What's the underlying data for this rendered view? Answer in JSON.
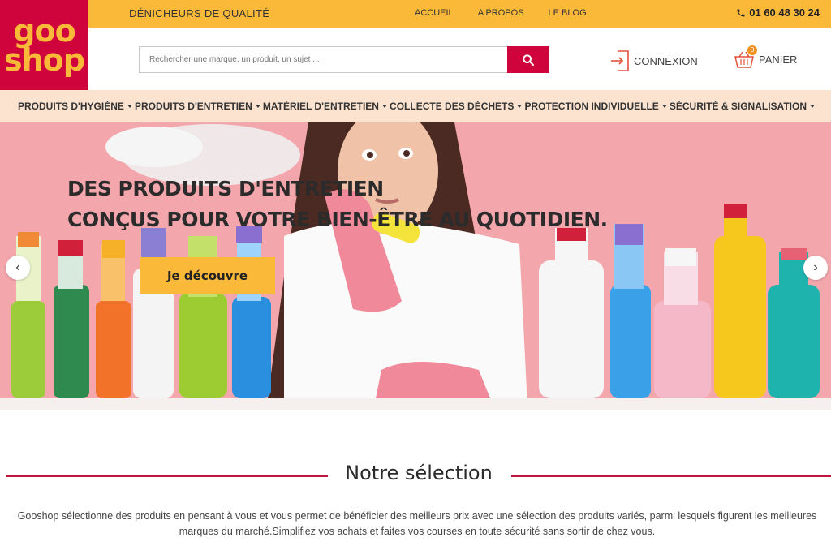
{
  "brand": {
    "logo_line1": "goo",
    "logo_line2": "shop",
    "tagline": "DÉNICHEURS DE QUALITÉ"
  },
  "top_links": [
    "ACCUEIL",
    "A PROPOS",
    "LE BLOG"
  ],
  "phone": "01 60 48 30 24",
  "search": {
    "placeholder": "Rechercher une marque, un produit, un sujet ..."
  },
  "account": {
    "login_label": "CONNEXION",
    "cart_label": "PANIER",
    "cart_count": "0"
  },
  "categories": [
    "PRODUITS D'HYGIÈNE",
    "PRODUITS D'ENTRETIEN",
    "MATÉRIEL D'ENTRETIEN",
    "COLLECTE DES DÉCHETS",
    "PROTECTION INDIVIDUELLE",
    "SÉCURITÉ & SIGNALISATION"
  ],
  "hero": {
    "title_line1": "DES PRODUITS D'ENTRETIEN",
    "title_line2": "CONÇUS POUR VOTRE BIEN-ÊTRE AU QUOTIDIEN.",
    "cta": "Je découvre"
  },
  "selection": {
    "title": "Notre sélection",
    "text": "Gooshop sélectionne des produits en pensant à vous et vous permet de bénéficier des meilleurs prix avec une sélection des produits variés, parmi lesquels figurent les meilleures marques du marché.Simplifiez vos achats et faites vos courses en toute sécurité sans sortir de chez vous."
  },
  "colors": {
    "brand_red": "#d0043c",
    "brand_yellow": "#fbb93a",
    "hero_pink": "#f3a7ad",
    "nav_bg": "#fbe3d0"
  }
}
